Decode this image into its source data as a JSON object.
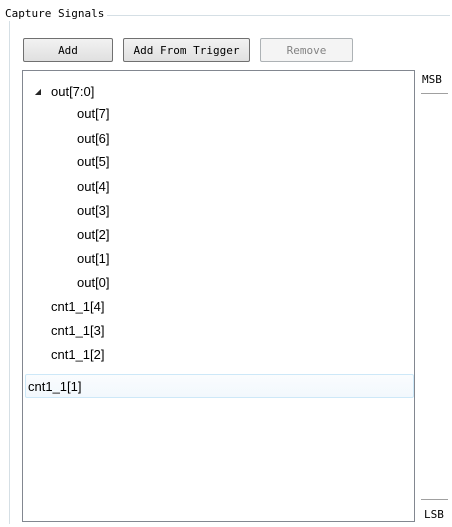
{
  "group": {
    "title": "Capture Signals"
  },
  "toolbar": {
    "add_label": "Add",
    "add_from_trigger_label": "Add From Trigger",
    "remove_label": "Remove",
    "remove_enabled": false
  },
  "tree": {
    "parent": {
      "label": "out[7:0]",
      "expanded": true
    },
    "children": [
      "out[7]",
      "out[6]",
      "out[5]",
      "out[4]",
      "out[3]",
      "out[2]",
      "out[1]",
      "out[0]"
    ],
    "top_level": [
      "cnt1_1[4]",
      "cnt1_1[3]",
      "cnt1_1[2]",
      "cnt1_1[1]"
    ],
    "selected": "cnt1_1[1]"
  },
  "axis": {
    "msb_label": "MSB",
    "lsb_label": "LSB"
  },
  "icons": {
    "expander": "triangle-down-icon"
  }
}
